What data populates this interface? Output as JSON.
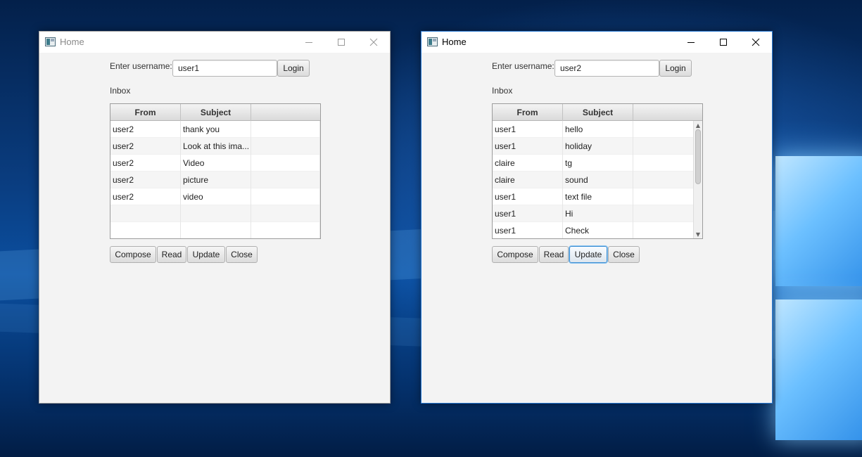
{
  "windows": [
    {
      "title": "Home",
      "active": false,
      "username_label": "Enter username:",
      "username_value": "user1",
      "login_label": "Login",
      "inbox_label": "Inbox",
      "columns": [
        "From",
        "Subject",
        ""
      ],
      "rows": [
        {
          "from": "user2",
          "subject": "thank you"
        },
        {
          "from": "user2",
          "subject": "Look at this ima..."
        },
        {
          "from": "user2",
          "subject": "Video"
        },
        {
          "from": "user2",
          "subject": "picture"
        },
        {
          "from": "user2",
          "subject": "video"
        },
        {
          "from": "",
          "subject": ""
        },
        {
          "from": "",
          "subject": ""
        }
      ],
      "buttons": {
        "compose": "Compose",
        "read": "Read",
        "update": "Update",
        "close": "Close"
      }
    },
    {
      "title": "Home",
      "active": true,
      "username_label": "Enter username:",
      "username_value": "user2",
      "login_label": "Login",
      "inbox_label": "Inbox",
      "columns": [
        "From",
        "Subject",
        ""
      ],
      "rows": [
        {
          "from": "user1",
          "subject": "hello"
        },
        {
          "from": "user1",
          "subject": "holiday"
        },
        {
          "from": "claire",
          "subject": "tg"
        },
        {
          "from": "claire",
          "subject": "sound"
        },
        {
          "from": "user1",
          "subject": "text file"
        },
        {
          "from": "user1",
          "subject": "Hi"
        },
        {
          "from": "user1",
          "subject": "Check"
        }
      ],
      "buttons": {
        "compose": "Compose",
        "read": "Read",
        "update": "Update",
        "close": "Close"
      },
      "focused_button": "update"
    }
  ],
  "icons": {
    "app": "app-window-icon",
    "minimize": "minimize-icon",
    "maximize": "maximize-icon",
    "close": "close-icon"
  },
  "colors": {
    "window_bg": "#f3f3f3",
    "focus_accent": "#3a8ed4",
    "desktop_bg": "#0b4fa0"
  }
}
